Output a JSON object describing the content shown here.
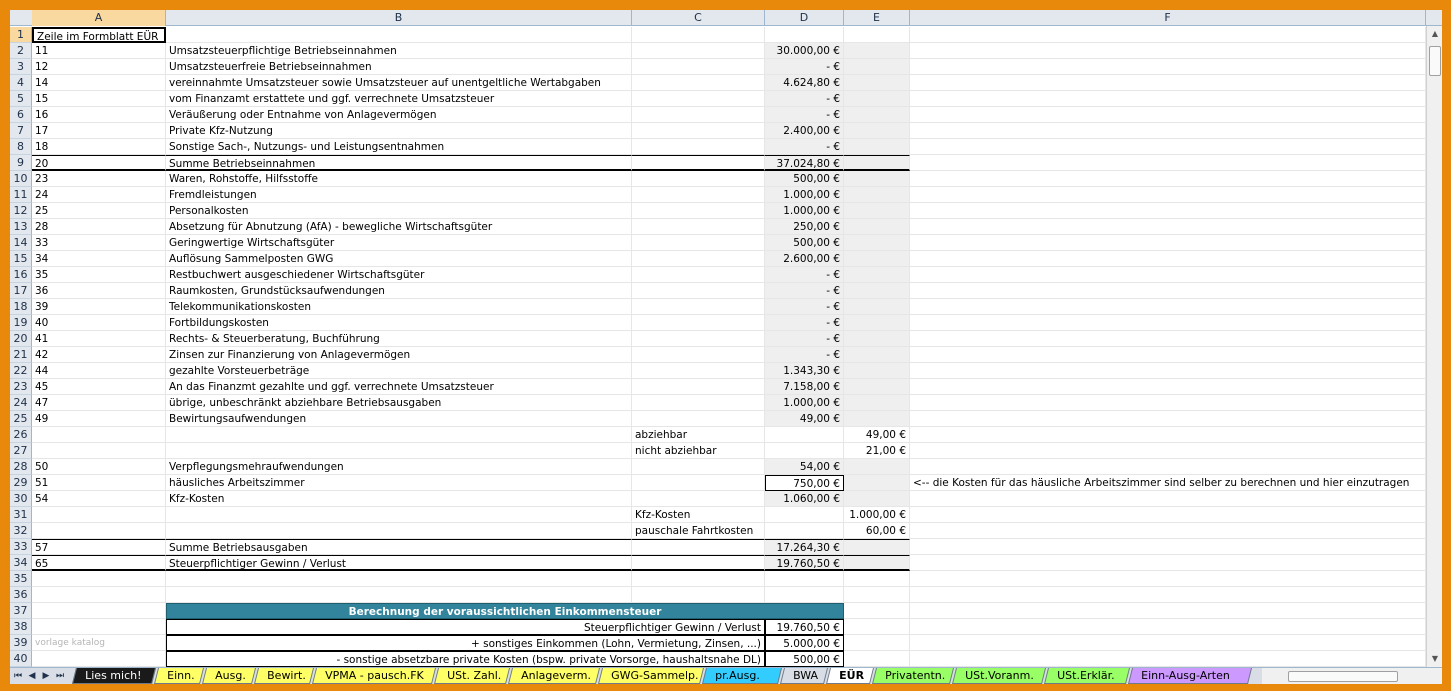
{
  "columns": [
    "A",
    "B",
    "C",
    "D",
    "E",
    "F"
  ],
  "rows": [
    {
      "n": "1",
      "A": "Zeile im Formblatt EÜR",
      "B": "",
      "C": "",
      "D": "",
      "E": "",
      "F": ""
    },
    {
      "n": "2",
      "A": "11",
      "B": "Umsatzsteuerpflichtige Betriebseinnahmen",
      "C": "",
      "D": "30.000,00 €",
      "E": "",
      "F": ""
    },
    {
      "n": "3",
      "A": "12",
      "B": "Umsatzsteuerfreie Betriebseinnahmen",
      "C": "",
      "D": "-      €",
      "E": "",
      "F": ""
    },
    {
      "n": "4",
      "A": "14",
      "B": "vereinnahmte Umsatzsteuer sowie Umsatzsteuer auf unentgeltliche Wertabgaben",
      "C": "",
      "D": "4.624,80 €",
      "E": "",
      "F": ""
    },
    {
      "n": "5",
      "A": "15",
      "B": "vom Finanzamt erstattete und ggf. verrechnete Umsatzsteuer",
      "C": "",
      "D": "-      €",
      "E": "",
      "F": ""
    },
    {
      "n": "6",
      "A": "16",
      "B": "Veräußerung oder Entnahme von Anlagevermögen",
      "C": "",
      "D": "-      €",
      "E": "",
      "F": ""
    },
    {
      "n": "7",
      "A": "17",
      "B": "Private Kfz-Nutzung",
      "C": "",
      "D": "2.400,00 €",
      "E": "",
      "F": ""
    },
    {
      "n": "8",
      "A": "18",
      "B": "Sonstige Sach-, Nutzungs- und Leistungsentnahmen",
      "C": "",
      "D": "-      €",
      "E": "",
      "F": ""
    },
    {
      "n": "9",
      "A": "20",
      "B": "Summe Betriebseinnahmen",
      "C": "",
      "D": "37.024,80 €",
      "E": "",
      "F": ""
    },
    {
      "n": "10",
      "A": "23",
      "B": "Waren, Rohstoffe, Hilfsstoffe",
      "C": "",
      "D": "500,00 €",
      "E": "",
      "F": ""
    },
    {
      "n": "11",
      "A": "24",
      "B": "Fremdleistungen",
      "C": "",
      "D": "1.000,00 €",
      "E": "",
      "F": ""
    },
    {
      "n": "12",
      "A": "25",
      "B": "Personalkosten",
      "C": "",
      "D": "1.000,00 €",
      "E": "",
      "F": ""
    },
    {
      "n": "13",
      "A": "28",
      "B": "Absetzung für Abnutzung (AfA) - bewegliche Wirtschaftsgüter",
      "C": "",
      "D": "250,00 €",
      "E": "",
      "F": ""
    },
    {
      "n": "14",
      "A": "33",
      "B": "Geringwertige Wirtschaftsgüter",
      "C": "",
      "D": "500,00 €",
      "E": "",
      "F": ""
    },
    {
      "n": "15",
      "A": "34",
      "B": "Auflösung Sammelposten GWG",
      "C": "",
      "D": "2.600,00 €",
      "E": "",
      "F": ""
    },
    {
      "n": "16",
      "A": "35",
      "B": "Restbuchwert ausgeschiedener Wirtschaftsgüter",
      "C": "",
      "D": "-      €",
      "E": "",
      "F": ""
    },
    {
      "n": "17",
      "A": "36",
      "B": "Raumkosten, Grundstücksaufwendungen",
      "C": "",
      "D": "-      €",
      "E": "",
      "F": ""
    },
    {
      "n": "18",
      "A": "39",
      "B": "Telekommunikationskosten",
      "C": "",
      "D": "-      €",
      "E": "",
      "F": ""
    },
    {
      "n": "19",
      "A": "40",
      "B": "Fortbildungskosten",
      "C": "",
      "D": "-      €",
      "E": "",
      "F": ""
    },
    {
      "n": "20",
      "A": "41",
      "B": "Rechts- & Steuerberatung, Buchführung",
      "C": "",
      "D": "-      €",
      "E": "",
      "F": ""
    },
    {
      "n": "21",
      "A": "42",
      "B": "Zinsen zur Finanzierung von Anlagevermögen",
      "C": "",
      "D": "-      €",
      "E": "",
      "F": ""
    },
    {
      "n": "22",
      "A": "44",
      "B": "gezahlte Vorsteuerbeträge",
      "C": "",
      "D": "1.343,30 €",
      "E": "",
      "F": ""
    },
    {
      "n": "23",
      "A": "45",
      "B": "An das Finanzmt gezahlte und ggf. verrechnete Umsatzsteuer",
      "C": "",
      "D": "7.158,00 €",
      "E": "",
      "F": ""
    },
    {
      "n": "24",
      "A": "47",
      "B": "übrige, unbeschränkt abziehbare Betriebsausgaben",
      "C": "",
      "D": "1.000,00 €",
      "E": "",
      "F": ""
    },
    {
      "n": "25",
      "A": "49",
      "B": "Bewirtungsaufwendungen",
      "C": "",
      "D": "49,00 €",
      "E": "",
      "F": ""
    },
    {
      "n": "26",
      "A": "",
      "B": "",
      "C": "abziehbar",
      "D": "",
      "E": "49,00 €",
      "F": ""
    },
    {
      "n": "27",
      "A": "",
      "B": "",
      "C": "nicht abziehbar",
      "D": "",
      "E": "21,00 €",
      "F": ""
    },
    {
      "n": "28",
      "A": "50",
      "B": "Verpflegungsmehraufwendungen",
      "C": "",
      "D": "54,00 €",
      "E": "",
      "F": ""
    },
    {
      "n": "29",
      "A": "51",
      "B": "häusliches Arbeitszimmer",
      "C": "",
      "D": "750,00 €",
      "E": "",
      "F": "<-- die Kosten für das häusliche Arbeitszimmer sind selber zu berechnen und hier einzutragen"
    },
    {
      "n": "30",
      "A": "54",
      "B": "Kfz-Kosten",
      "C": "",
      "D": "1.060,00 €",
      "E": "",
      "F": ""
    },
    {
      "n": "31",
      "A": "",
      "B": "",
      "C": "Kfz-Kosten",
      "D": "",
      "E": "1.000,00 €",
      "F": ""
    },
    {
      "n": "32",
      "A": "",
      "B": "",
      "C": "pauschale Fahrtkosten",
      "D": "",
      "E": "60,00 €",
      "F": ""
    },
    {
      "n": "33",
      "A": "57",
      "B": "Summe Betriebsausgaben",
      "C": "",
      "D": "17.264,30 €",
      "E": "",
      "F": ""
    },
    {
      "n": "34",
      "A": "65",
      "B": "Steuerpflichtiger Gewinn / Verlust",
      "C": "",
      "D": "19.760,50 €",
      "E": "",
      "F": ""
    },
    {
      "n": "35",
      "A": "",
      "B": "",
      "C": "",
      "D": "",
      "E": "",
      "F": ""
    },
    {
      "n": "36",
      "A": "",
      "B": "",
      "C": "",
      "D": "",
      "E": "",
      "F": ""
    },
    {
      "n": "37",
      "A": "",
      "B": "Berechnung der voraussichtlichen Einkommensteuer",
      "C": "",
      "D": "",
      "E": "",
      "F": ""
    },
    {
      "n": "38",
      "A": "",
      "B": "Steuerpflichtiger Gewinn / Verlust",
      "C": "",
      "D": "19.760,50 €",
      "E": "",
      "F": ""
    },
    {
      "n": "39",
      "A": "vorlage katalog",
      "B": "+ sonstiges Einkommen (Lohn, Vermietung, Zinsen, ...)",
      "C": "",
      "D": "5.000,00 €",
      "E": "",
      "F": ""
    },
    {
      "n": "40",
      "A": "",
      "B": "- sonstige absetzbare private Kosten (bspw. private Vorsorge, haushaltsnahe DL)",
      "C": "",
      "D": "500,00 €",
      "E": "",
      "F": ""
    }
  ],
  "tabs": [
    "Lies mich!",
    "Einn.",
    "Ausg.",
    "Bewirt.",
    "VPMA - pausch.FK",
    "USt. Zahl.",
    "Anlageverm.",
    "GWG-Sammelp.",
    "pr.Ausg.",
    "BWA",
    "EÜR",
    "Privatentn.",
    "USt.Voranm.",
    "USt.Erklär.",
    "Einn-Ausg-Arten"
  ],
  "active_tab": "EÜR",
  "colors": {
    "frame": "#e8890c",
    "table_header": "#31849b",
    "tab_lies_mich": "#1a1a1a",
    "tab_yellow": "#ffff66",
    "tab_blue": "#33ccff",
    "tab_green": "#99ff66",
    "tab_purple": "#cc99ff"
  }
}
